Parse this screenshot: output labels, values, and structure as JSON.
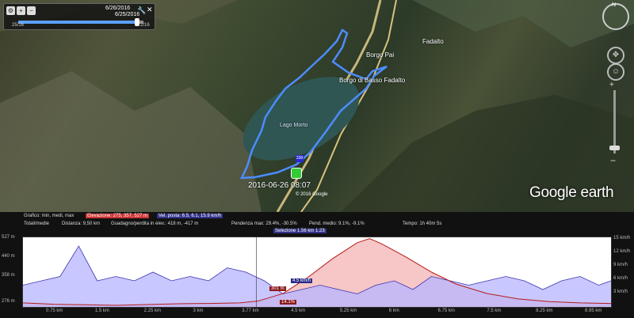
{
  "window": {
    "title": "Google Earth"
  },
  "time_slider": {
    "date_top": "6/26/2016",
    "date_bottom": "6/25/2016",
    "label_left": "25/16",
    "label_right": "2/16",
    "position": 0.95
  },
  "map": {
    "labels": [
      {
        "id": "fadalto",
        "text": "Fadalto"
      },
      {
        "id": "borgo-pai",
        "text": "Borgo Pai"
      },
      {
        "id": "borgo-basso",
        "text": "Borgo di Basso Fadalto"
      },
      {
        "id": "lago",
        "text": "Lago Morto"
      }
    ],
    "cursor_time": "2016-06-26 08:07",
    "copyright": "© 2016 Google",
    "logo": "Google earth",
    "marker_label": "338"
  },
  "nav": {
    "north": "N"
  },
  "profile": {
    "row1": {
      "graph_label": "Grafico: min, medi, max",
      "elevation": "Elevazione: 275, 357, 527 m",
      "speed": "Vel. posta: 6.5, 6.1, 15.9 km/h"
    },
    "row2": {
      "totals": "Totali/medie",
      "distance": "Distanza: 9,50 km",
      "gain_loss": "Guadagno/perdita in elev.: 418 m, -417 m",
      "max_slope": "Pendenza max: 29.4%, -30.5%",
      "avg_slope": "Pend. medio: 9.1%, -9.1%",
      "time": "Tempo: 1h 40m 5s"
    },
    "selection_label": "Selezione 1.56 km 1.23",
    "y_left": [
      "527 m",
      "440 m",
      "358 m",
      "276 m"
    ],
    "y_right": [
      "15 km/h",
      "12 km/h",
      "9 km/h",
      "6 km/h",
      "3 km/h"
    ],
    "x_ticks": [
      "0.75 km",
      "1.5 km",
      "2.25 km",
      "3 km",
      "3.77 km",
      "4.5 km",
      "5.25 km",
      "6 km",
      "6.75 km",
      "7.5 km",
      "8.25 km",
      "8.95 km"
    ],
    "annotations": {
      "elev": "301 m",
      "speed": "4.5 km/h",
      "slope": "14.1%"
    }
  },
  "colors": {
    "track": "#4d8cff",
    "elev_line": "#b31b1b",
    "speed_fill": "#b7b4ff",
    "elev_fill": "#f7c6c6"
  },
  "chart_data": {
    "type": "area",
    "x_unit": "km",
    "x_range": [
      0,
      9.5
    ],
    "series": [
      {
        "name": "Elevazione",
        "unit": "m",
        "x": [
          0,
          0.5,
          1,
          1.5,
          2,
          2.5,
          3,
          3.5,
          3.8,
          4.2,
          4.6,
          5,
          5.4,
          5.6,
          5.8,
          6.2,
          6.6,
          7,
          7.5,
          8,
          8.5,
          9,
          9.5
        ],
        "y": [
          285,
          280,
          278,
          276,
          279,
          282,
          283,
          285,
          292,
          320,
          380,
          450,
          510,
          525,
          505,
          455,
          400,
          355,
          320,
          300,
          290,
          285,
          283
        ]
      },
      {
        "name": "Velocità",
        "unit": "km/h",
        "values_note": "",
        "x": [
          0,
          0.3,
          0.6,
          0.9,
          1.2,
          1.5,
          1.8,
          2.1,
          2.4,
          2.7,
          3,
          3.3,
          3.6,
          3.9,
          4.2,
          4.5,
          4.8,
          5.1,
          5.4,
          5.7,
          6,
          6.3,
          6.6,
          6.9,
          7.2,
          7.5,
          7.8,
          8.1,
          8.4,
          8.7,
          9,
          9.3,
          9.5
        ],
        "y": [
          5,
          6,
          7,
          14,
          6,
          7,
          6,
          8,
          6,
          7,
          6,
          9,
          8,
          6,
          3,
          4,
          5,
          4,
          3,
          5,
          6,
          4,
          7,
          6,
          5,
          6,
          7,
          6,
          4,
          6,
          7,
          5,
          6
        ]
      }
    ],
    "ylim_left": [
      270,
      530
    ],
    "ylim_right": [
      0,
      16
    ]
  }
}
